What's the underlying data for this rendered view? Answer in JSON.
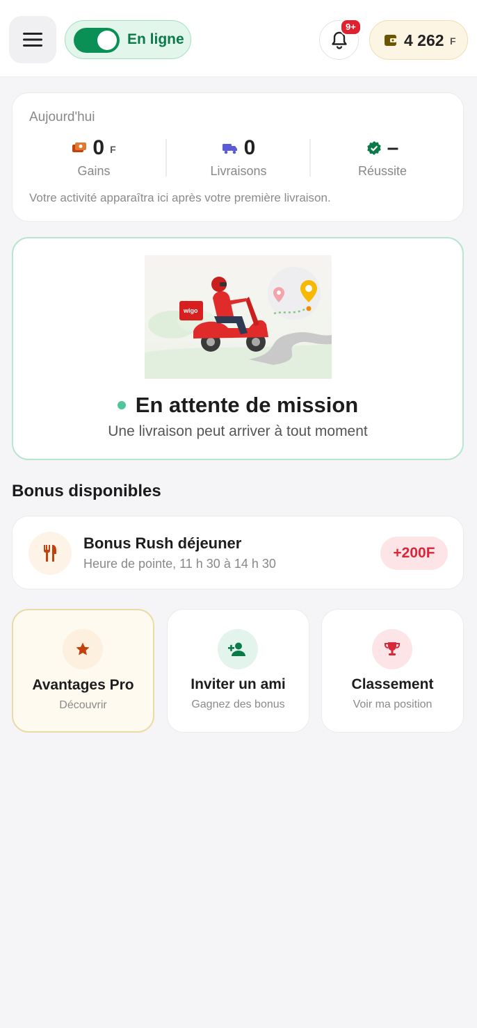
{
  "header": {
    "online_label": "En ligne",
    "notification_badge": "9+",
    "wallet_amount": "4 262",
    "wallet_currency": "F"
  },
  "today": {
    "title": "Aujourd'hui",
    "stats": [
      {
        "value": "0",
        "unit": "F",
        "label": "Gains"
      },
      {
        "value": "0",
        "unit": "",
        "label": "Livraisons"
      },
      {
        "value": "–",
        "unit": "",
        "label": "Réussite"
      }
    ],
    "note": "Votre activité apparaîtra ici après votre première livraison."
  },
  "mission": {
    "title": "En attente de mission",
    "subtitle": "Une livraison peut arriver à tout moment",
    "illustration_brand": "wigo"
  },
  "bonus_section": {
    "title": "Bonus disponibles",
    "items": [
      {
        "title": "Bonus Rush déjeuner",
        "subtitle": "Heure de pointe, 11 h 30 à 14 h 30",
        "amount": "+200F",
        "icon": "cutlery-icon"
      }
    ]
  },
  "tiles": [
    {
      "title": "Avantages Pro",
      "subtitle": "Découvrir",
      "icon": "star-icon"
    },
    {
      "title": "Inviter un ami",
      "subtitle": "Gagnez des bonus",
      "icon": "add-user-icon"
    },
    {
      "title": "Classement",
      "subtitle": "Voir ma position",
      "icon": "trophy-icon"
    }
  ],
  "colors": {
    "primary_green": "#0a8f55",
    "online_bg": "#e3f6ec",
    "badge_red": "#e0202f",
    "wallet_bg": "#fdf5e3",
    "bonus_red": "#d8263a",
    "pro_accent": "#c2410c"
  }
}
